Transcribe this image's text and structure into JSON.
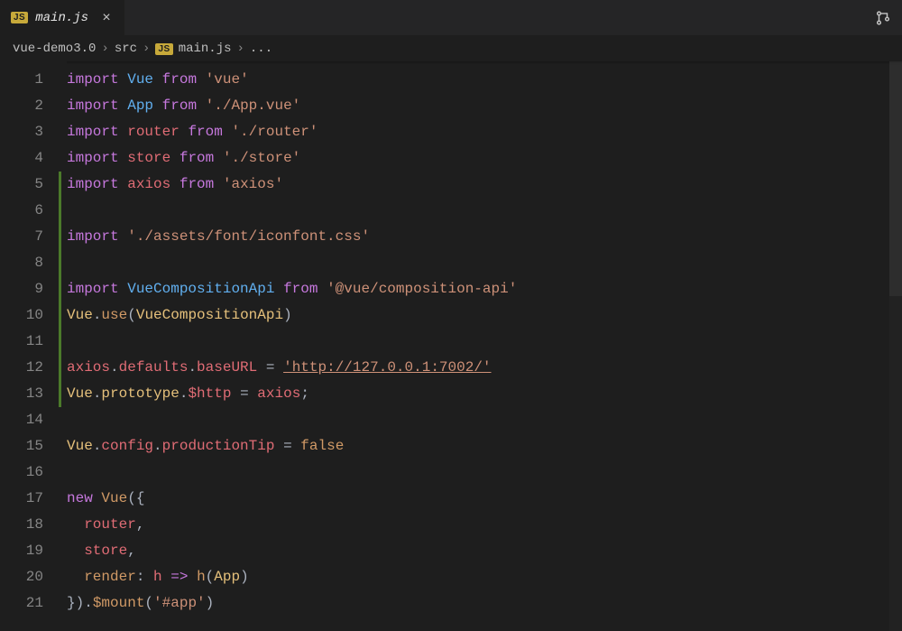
{
  "tab": {
    "icon_label": "JS",
    "filename": "main.js",
    "close_glyph": "×"
  },
  "breadcrumb": {
    "project": "vue-demo3.0",
    "folder": "src",
    "icon_label": "JS",
    "file": "main.js",
    "trailing": "...",
    "chevron": "›"
  },
  "gutter": {
    "start": 1,
    "end": 21,
    "modified_lines": [
      5,
      6,
      7,
      8,
      9,
      10,
      11,
      12,
      13
    ]
  },
  "code": {
    "lines": [
      [
        [
          "kw",
          "import"
        ],
        [
          "plain",
          " "
        ],
        [
          "varb",
          "Vue"
        ],
        [
          "plain",
          " "
        ],
        [
          "from",
          "from"
        ],
        [
          "plain",
          " "
        ],
        [
          "str",
          "'vue'"
        ]
      ],
      [
        [
          "kw",
          "import"
        ],
        [
          "plain",
          " "
        ],
        [
          "varb",
          "App"
        ],
        [
          "plain",
          " "
        ],
        [
          "from",
          "from"
        ],
        [
          "plain",
          " "
        ],
        [
          "str",
          "'./App.vue'"
        ]
      ],
      [
        [
          "kw",
          "import"
        ],
        [
          "plain",
          " "
        ],
        [
          "var",
          "router"
        ],
        [
          "plain",
          " "
        ],
        [
          "from",
          "from"
        ],
        [
          "plain",
          " "
        ],
        [
          "str",
          "'./router'"
        ]
      ],
      [
        [
          "kw",
          "import"
        ],
        [
          "plain",
          " "
        ],
        [
          "var",
          "store"
        ],
        [
          "plain",
          " "
        ],
        [
          "from",
          "from"
        ],
        [
          "plain",
          " "
        ],
        [
          "str",
          "'./store'"
        ]
      ],
      [
        [
          "kw",
          "import"
        ],
        [
          "plain",
          " "
        ],
        [
          "var",
          "axios"
        ],
        [
          "plain",
          " "
        ],
        [
          "from",
          "from"
        ],
        [
          "plain",
          " "
        ],
        [
          "str",
          "'axios'"
        ]
      ],
      [],
      [
        [
          "kw",
          "import"
        ],
        [
          "plain",
          " "
        ],
        [
          "str",
          "'./assets/font/iconfont.css'"
        ]
      ],
      [],
      [
        [
          "kw",
          "import"
        ],
        [
          "plain",
          " "
        ],
        [
          "varb",
          "VueCompositionApi"
        ],
        [
          "plain",
          " "
        ],
        [
          "from",
          "from"
        ],
        [
          "plain",
          " "
        ],
        [
          "str",
          "'@vue/composition-api'"
        ]
      ],
      [
        [
          "ident",
          "Vue"
        ],
        [
          "punc",
          "."
        ],
        [
          "call",
          "use"
        ],
        [
          "punc",
          "("
        ],
        [
          "ident",
          "VueCompositionApi"
        ],
        [
          "punc",
          ")"
        ]
      ],
      [],
      [
        [
          "var",
          "axios"
        ],
        [
          "punc",
          "."
        ],
        [
          "var",
          "defaults"
        ],
        [
          "punc",
          "."
        ],
        [
          "var",
          "baseURL"
        ],
        [
          "plain",
          " "
        ],
        [
          "punc",
          "="
        ],
        [
          "plain",
          " "
        ],
        [
          "str-u",
          "'http://127.0.0.1:7002/'"
        ]
      ],
      [
        [
          "ident",
          "Vue"
        ],
        [
          "punc",
          "."
        ],
        [
          "ident",
          "prototype"
        ],
        [
          "punc",
          "."
        ],
        [
          "var",
          "$http"
        ],
        [
          "plain",
          " "
        ],
        [
          "punc",
          "="
        ],
        [
          "plain",
          " "
        ],
        [
          "var",
          "axios"
        ],
        [
          "punc",
          ";"
        ]
      ],
      [],
      [
        [
          "ident",
          "Vue"
        ],
        [
          "punc",
          "."
        ],
        [
          "var",
          "config"
        ],
        [
          "punc",
          "."
        ],
        [
          "var",
          "productionTip"
        ],
        [
          "plain",
          " "
        ],
        [
          "punc",
          "="
        ],
        [
          "plain",
          " "
        ],
        [
          "bool",
          "false"
        ]
      ],
      [],
      [
        [
          "new",
          "new"
        ],
        [
          "plain",
          " "
        ],
        [
          "call",
          "Vue"
        ],
        [
          "punc",
          "({"
        ]
      ],
      [
        [
          "plain",
          "  "
        ],
        [
          "var",
          "router"
        ],
        [
          "punc",
          ","
        ]
      ],
      [
        [
          "plain",
          "  "
        ],
        [
          "var",
          "store"
        ],
        [
          "punc",
          ","
        ]
      ],
      [
        [
          "plain",
          "  "
        ],
        [
          "call",
          "render"
        ],
        [
          "punc",
          ":"
        ],
        [
          "plain",
          " "
        ],
        [
          "var",
          "h"
        ],
        [
          "plain",
          " "
        ],
        [
          "kw",
          "=>"
        ],
        [
          "plain",
          " "
        ],
        [
          "call",
          "h"
        ],
        [
          "punc",
          "("
        ],
        [
          "ident",
          "App"
        ],
        [
          "punc",
          ")"
        ]
      ],
      [
        [
          "punc",
          "})."
        ],
        [
          "call",
          "$mount"
        ],
        [
          "punc",
          "("
        ],
        [
          "str",
          "'#app'"
        ],
        [
          "punc",
          ")"
        ]
      ]
    ]
  }
}
